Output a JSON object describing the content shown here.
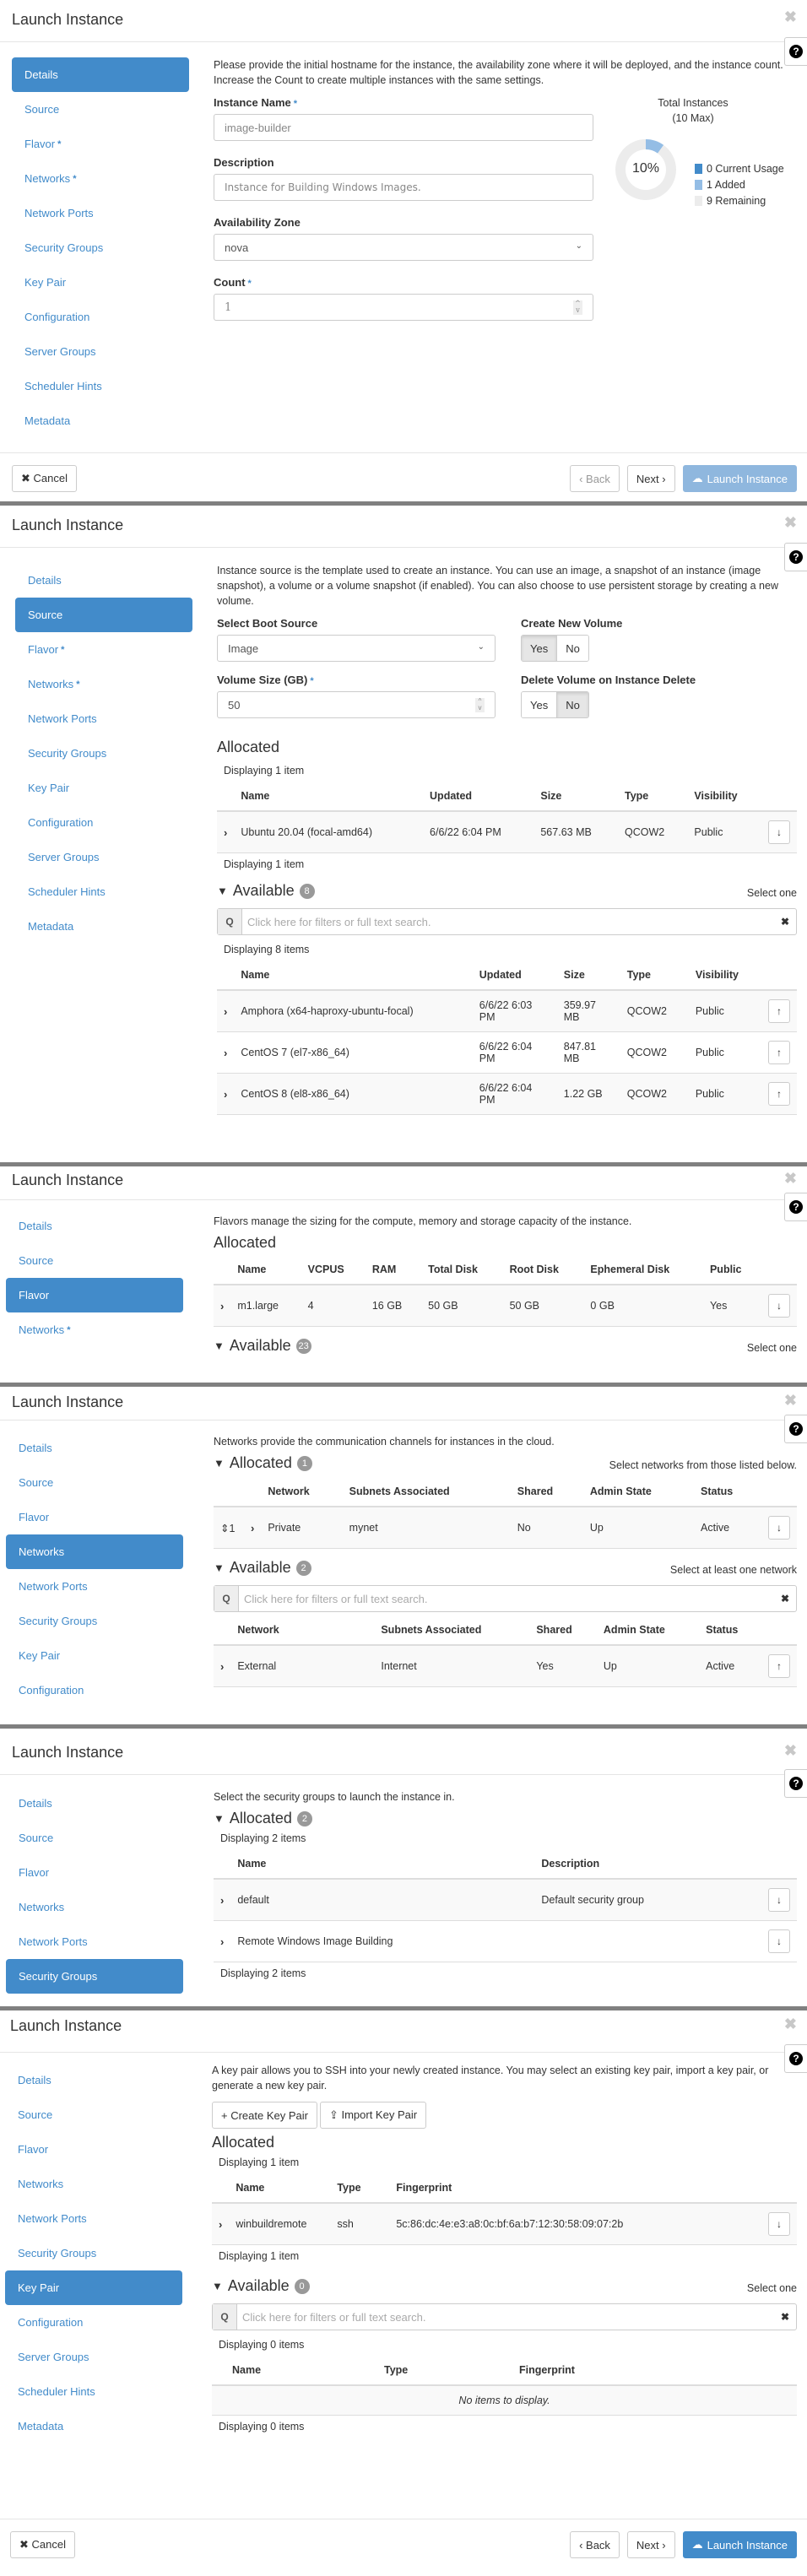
{
  "modal_title": "Launch Instance",
  "close_glyph": "✖",
  "help_glyph": "?",
  "required_mark": "*",
  "colors": {
    "primary": "#428bca",
    "primary_disabled": "#8fb7de",
    "donut_added": "#94bde5",
    "donut_remaining": "#ececec",
    "separator": "#808080"
  },
  "nav_items": {
    "details": "Details",
    "source": "Source",
    "flavor": "Flavor",
    "networks": "Networks",
    "network_ports": "Network Ports",
    "security_groups": "Security Groups",
    "key_pair": "Key Pair",
    "configuration": "Configuration",
    "server_groups": "Server Groups",
    "scheduler_hints": "Scheduler Hints",
    "metadata": "Metadata"
  },
  "footer": {
    "cancel": "✖ Cancel",
    "back": "‹ Back",
    "next": "Next ›",
    "launch": "Launch Instance",
    "launch_icon": "cloud-upload-icon"
  },
  "common": {
    "search_placeholder": "Click here for filters or full text search.",
    "search_icon": "Q",
    "clear_icon": "✖",
    "row_expand": "›",
    "arrow_down": "↓",
    "arrow_up": "↑",
    "collapse_chev": "⌄",
    "select_one": "Select one"
  },
  "details": {
    "description": "Please provide the initial hostname for the instance, the availability zone where it will be deployed, and the instance count. Increase the Count to create multiple instances with the same settings.",
    "instance_name_label": "Instance Name",
    "instance_name_value": "image-builder",
    "description_label": "Description",
    "description_value": "Instance for Building Windows Images.",
    "az_label": "Availability Zone",
    "az_value": "nova",
    "count_label": "Count",
    "count_value": "1",
    "quota": {
      "title": "Total Instances",
      "subtitle": "(10 Max)",
      "percent_label": "10%",
      "max": 10,
      "current_usage": 0,
      "added": 1,
      "remaining": 9,
      "legend": [
        "0 Current Usage",
        "1 Added",
        "9 Remaining"
      ]
    }
  },
  "source": {
    "description": "Instance source is the template used to create an instance. You can use an image, a snapshot of an instance (image snapshot), a volume or a volume snapshot (if enabled). You can also choose to use persistent storage by creating a new volume.",
    "boot_source_label": "Select Boot Source",
    "boot_source_value": "Image",
    "create_volume_label": "Create New Volume",
    "volume_size_label": "Volume Size (GB)",
    "volume_size_value": "50",
    "delete_volume_label": "Delete Volume on Instance Delete",
    "yes": "Yes",
    "no": "No",
    "create_volume_selected": "Yes",
    "delete_volume_selected": "No",
    "allocated_title": "Allocated",
    "allocated_count_text": "Displaying 1 item",
    "columns": [
      "Name",
      "Updated",
      "Size",
      "Type",
      "Visibility"
    ],
    "allocated_rows": [
      {
        "name": "Ubuntu 20.04 (focal-amd64)",
        "updated": "6/6/22 6:04 PM",
        "size": "567.63 MB",
        "type": "QCOW2",
        "visibility": "Public"
      }
    ],
    "available_title": "Available",
    "available_count": "8",
    "available_count_text": "Displaying 8 items",
    "available_rows": [
      {
        "name": "Amphora (x64-haproxy-ubuntu-focal)",
        "updated": "6/6/22 6:03 PM",
        "size": "359.97 MB",
        "type": "QCOW2",
        "visibility": "Public"
      },
      {
        "name": "CentOS 7 (el7-x86_64)",
        "updated": "6/6/22 6:04 PM",
        "size": "847.81 MB",
        "type": "QCOW2",
        "visibility": "Public"
      },
      {
        "name": "CentOS 8 (el8-x86_64)",
        "updated": "6/6/22 6:04 PM",
        "size": "1.22 GB",
        "type": "QCOW2",
        "visibility": "Public"
      }
    ]
  },
  "flavor": {
    "description": "Flavors manage the sizing for the compute, memory and storage capacity of the instance.",
    "allocated_title": "Allocated",
    "columns": [
      "Name",
      "VCPUS",
      "RAM",
      "Total Disk",
      "Root Disk",
      "Ephemeral Disk",
      "Public"
    ],
    "allocated_rows": [
      {
        "name": "m1.large",
        "vcpus": "4",
        "ram": "16 GB",
        "total_disk": "50 GB",
        "root_disk": "50 GB",
        "ephemeral_disk": "0 GB",
        "public": "Yes"
      }
    ],
    "available_title": "Available",
    "available_count": "23"
  },
  "networks": {
    "description": "Networks provide the communication channels for instances in the cloud.",
    "allocated_title": "Allocated",
    "allocated_count": "1",
    "allocated_hint": "Select networks from those listed below.",
    "columns": [
      "Network",
      "Subnets Associated",
      "Shared",
      "Admin State",
      "Status"
    ],
    "allocated_rows": [
      {
        "order": "1",
        "network": "Private",
        "subnets": "mynet",
        "shared": "No",
        "admin_state": "Up",
        "status": "Active"
      }
    ],
    "available_title": "Available",
    "available_count": "2",
    "available_hint": "Select at least one network",
    "available_rows": [
      {
        "network": "External",
        "subnets": "Internet",
        "shared": "Yes",
        "admin_state": "Up",
        "status": "Active"
      }
    ]
  },
  "security_groups": {
    "description": "Select the security groups to launch the instance in.",
    "allocated_title": "Allocated",
    "allocated_count": "2",
    "count_text": "Displaying 2 items",
    "columns": [
      "Name",
      "Description"
    ],
    "rows": [
      {
        "name": "default",
        "description": "Default security group"
      },
      {
        "name": "Remote Windows Image Building",
        "description": ""
      }
    ]
  },
  "key_pair": {
    "description": "A key pair allows you to SSH into your newly created instance. You may select an existing key pair, import a key pair, or generate a new key pair.",
    "create_button": "+ Create Key Pair",
    "import_button": "⇪ Import Key Pair",
    "allocated_title": "Allocated",
    "allocated_count_text": "Displaying 1 item",
    "columns": [
      "Name",
      "Type",
      "Fingerprint"
    ],
    "allocated_rows": [
      {
        "name": "winbuildremote",
        "type": "ssh",
        "fingerprint": "5c:86:dc:4e:e3:a8:0c:bf:6a:b7:12:30:58:09:07:2b"
      }
    ],
    "available_title": "Available",
    "available_count": "0",
    "available_count_text": "Displaying 0 items",
    "empty_text": "No items to display."
  }
}
